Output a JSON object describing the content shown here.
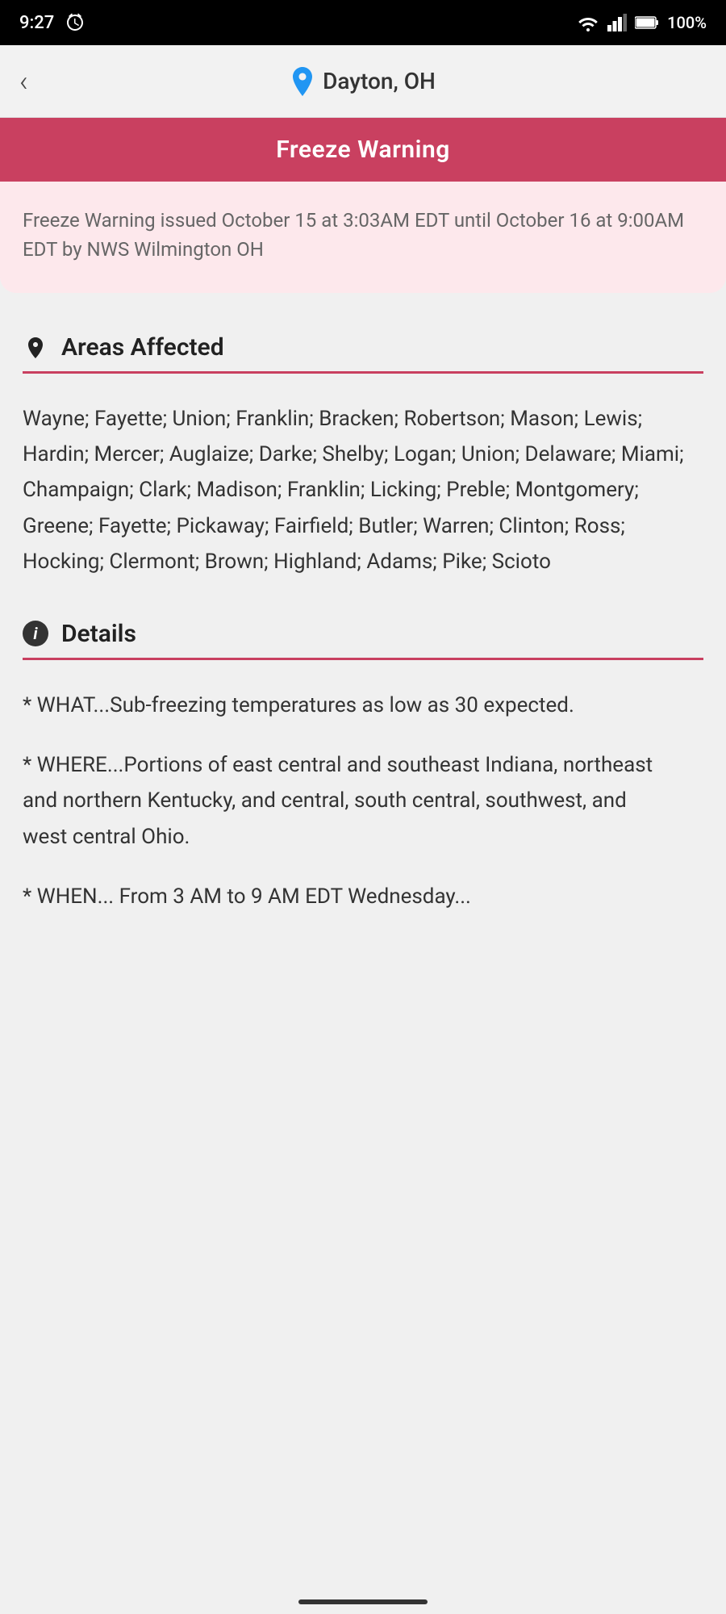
{
  "statusBar": {
    "time": "9:27",
    "battery": "100%"
  },
  "header": {
    "locationLabel": "Dayton, OH",
    "backLabel": "‹"
  },
  "warningBanner": {
    "title": "Freeze Warning"
  },
  "warningDescription": {
    "text": "Freeze Warning issued October 15 at 3:03AM EDT until October 16 at 9:00AM EDT by NWS Wilmington OH"
  },
  "areasAffected": {
    "sectionTitle": "Areas Affected",
    "content": "Wayne; Fayette; Union; Franklin; Bracken; Robertson; Mason; Lewis; Hardin; Mercer; Auglaize; Darke; Shelby; Logan; Union; Delaware; Miami; Champaign; Clark; Madison; Franklin; Licking; Preble; Montgomery; Greene; Fayette; Pickaway; Fairfield; Butler; Warren; Clinton; Ross; Hocking; Clermont; Brown; Highland; Adams; Pike; Scioto"
  },
  "details": {
    "sectionTitle": "Details",
    "paragraph1": "* WHAT...Sub-freezing temperatures as low as 30 expected.",
    "paragraph2": "* WHERE...Portions of east central and southeast Indiana, northeast\nand northern Kentucky, and central, south central, southwest, and\nwest central Ohio.",
    "paragraph3": "* WHEN... From 3 AM to 9 AM EDT Wednesday..."
  },
  "colors": {
    "warningRed": "#c94060",
    "warningPink": "#fde8ec",
    "locationBlue": "#2196F3"
  }
}
